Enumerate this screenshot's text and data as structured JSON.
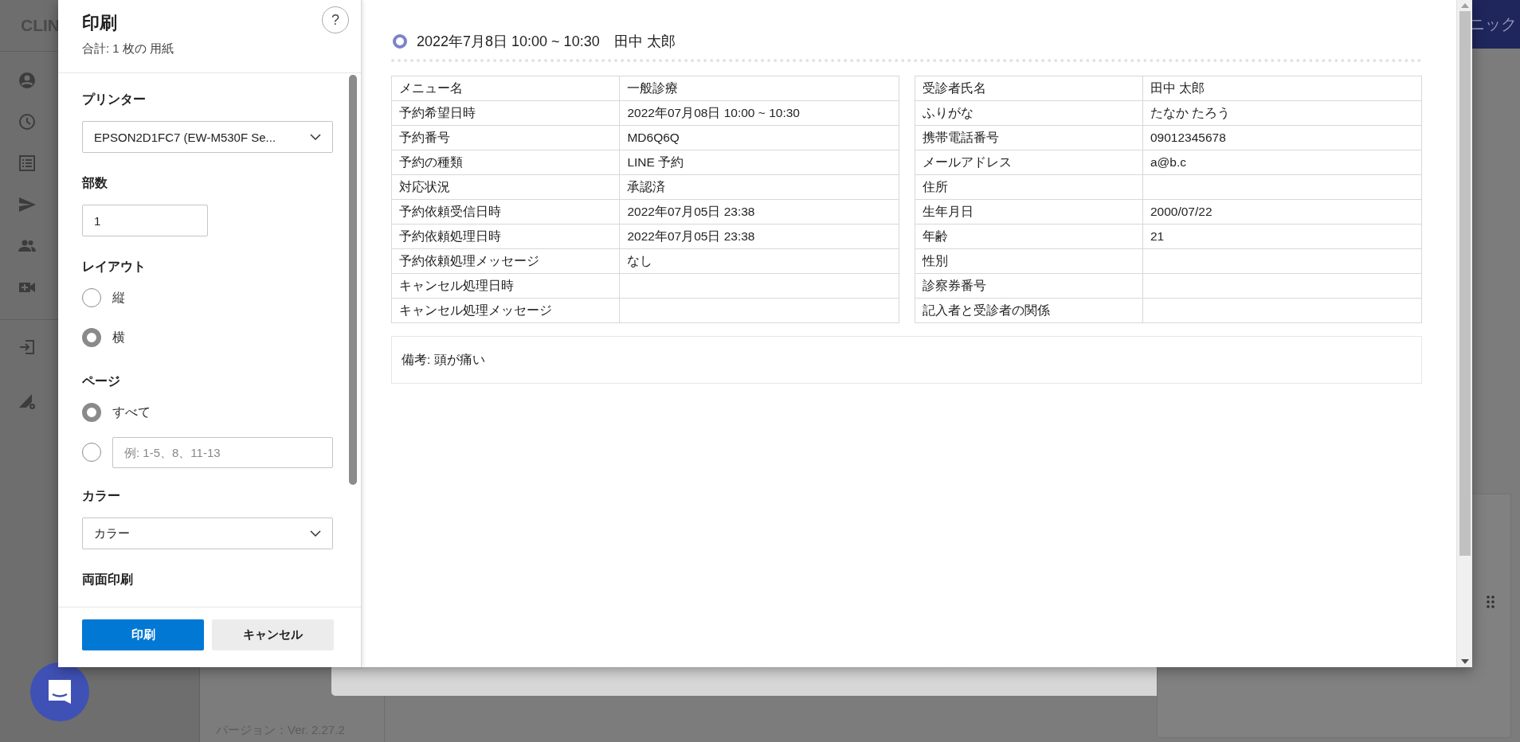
{
  "background_app": {
    "logo": "CLIN",
    "header_text": "ニック",
    "version": "バージョン：Ver. 2.27.2"
  },
  "print_dialog": {
    "title": "印刷",
    "summary": "合計: 1 枚の 用紙",
    "help": "?",
    "sections": [
      {
        "kind": "select",
        "label": "プリンター",
        "value": "EPSON2D1FC7 (EW-M530F Se..."
      },
      {
        "kind": "number",
        "label": "部数",
        "value": "1"
      },
      {
        "kind": "radio",
        "label": "レイアウト",
        "options": [
          {
            "kind": "label",
            "label": "縦",
            "selected": false
          },
          {
            "kind": "label",
            "label": "横",
            "selected": true
          }
        ]
      },
      {
        "kind": "radio",
        "label": "ページ",
        "options": [
          {
            "kind": "label",
            "label": "すべて",
            "selected": true
          },
          {
            "kind": "input",
            "placeholder": "例: 1-5、8、11-13",
            "selected": false
          }
        ]
      },
      {
        "kind": "select",
        "label": "カラー",
        "value": "カラー"
      },
      {
        "kind": "heading",
        "label": "両面印刷"
      }
    ],
    "buttons": [
      {
        "kind": "primary",
        "label": "印刷"
      },
      {
        "kind": "secondary",
        "label": "キャンセル"
      }
    ]
  },
  "preview": {
    "date_time": "2022年7月8日 10:00 ~ 10:30",
    "name": "田中 太郎",
    "tables": [
      {
        "rows": [
          {
            "label": "メニュー名",
            "value": "一般診療"
          },
          {
            "label": "予約希望日時",
            "value": "2022年07月08日 10:00 ~ 10:30"
          },
          {
            "label": "予約番号",
            "value": "MD6Q6Q"
          },
          {
            "label": "予約の種類",
            "value": "LINE 予約"
          },
          {
            "label": "対応状況",
            "value": "承認済"
          },
          {
            "label": "予約依頼受信日時",
            "value": "2022年07月05日 23:38"
          },
          {
            "label": "予約依頼処理日時",
            "value": "2022年07月05日 23:38"
          },
          {
            "label": "予約依頼処理メッセージ",
            "value": "なし"
          },
          {
            "label": "キャンセル処理日時"
          },
          {
            "label": "キャンセル処理メッセージ"
          }
        ]
      },
      {
        "rows": [
          {
            "label": "受診者氏名",
            "value": "田中 太郎"
          },
          {
            "label": "ふりがな",
            "value": "たなか たろう"
          },
          {
            "label": "携帯電話番号",
            "value": "09012345678"
          },
          {
            "label": "メールアドレス",
            "value": "a@b.c"
          },
          {
            "label": "住所"
          },
          {
            "label": "生年月日",
            "value": "2000/07/22"
          },
          {
            "label": "年齢",
            "value": "21"
          },
          {
            "label": "性別"
          },
          {
            "label": "診察券番号"
          },
          {
            "label": "記入者と受診者の関係"
          }
        ]
      }
    ],
    "note": "備考: 頭が痛い"
  }
}
